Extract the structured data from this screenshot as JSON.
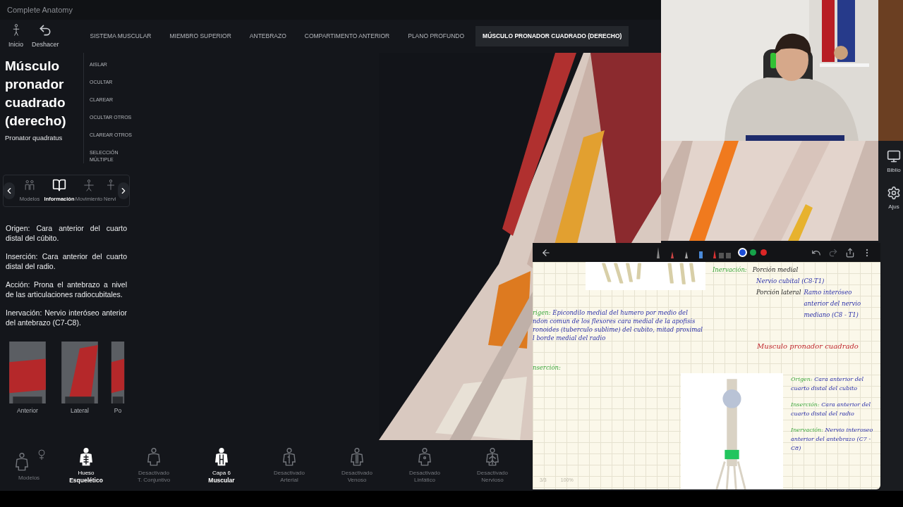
{
  "window": {
    "title": "Complete Anatomy"
  },
  "toolbar": [
    {
      "label": "Inicio",
      "kind": "home"
    },
    {
      "label": "Deshacer",
      "kind": "undo"
    }
  ],
  "breadcrumbs": [
    {
      "label": "SISTEMA MUSCULAR",
      "selected": false
    },
    {
      "label": "MIEMBRO SUPERIOR",
      "selected": false
    },
    {
      "label": "ANTEBRAZO",
      "selected": false
    },
    {
      "label": "COMPARTIMENTO ANTERIOR",
      "selected": false
    },
    {
      "label": "PLANO PROFUNDO",
      "selected": false
    },
    {
      "label": "MÚSCULO PRONADOR CUADRADO (DERECHO)",
      "selected": true
    }
  ],
  "structure": {
    "title": "Músculo pronador cuadrado (derecho)",
    "latin": "Pronator quadratus"
  },
  "actions": [
    "AISLAR",
    "OCULTAR",
    "CLAREAR",
    "OCULTAR OTROS",
    "CLAREAR OTROS",
    "SELECCIÓN MÚLTIPLE"
  ],
  "panel_tabs": [
    {
      "label": "Modelos",
      "kind": "models",
      "selected": false
    },
    {
      "label": "Información",
      "kind": "info",
      "selected": true
    },
    {
      "label": "Movimiento",
      "kind": "movement",
      "selected": false
    },
    {
      "label": "Nervi",
      "kind": "nerve",
      "selected": false
    }
  ],
  "info": [
    "Origen: Cara anterior del cuarto distal del cúbito.",
    "Inserción: Cara anterior del cuarto distal del radio.",
    "Acción: Prona el antebrazo a nivel de las articulaciones radiocubitales.",
    "Inervación: Nervio interóseo anterior del antebrazo (C7-C8)."
  ],
  "views": [
    "Anterior",
    "Lateral",
    "Po"
  ],
  "layers": [
    {
      "kind": "models",
      "top": "Modelos",
      "active": false
    },
    {
      "kind": "bone",
      "top": "Hueso",
      "bottom": "Esquelético",
      "active": true
    },
    {
      "kind": "connective",
      "top": "Desactivado",
      "bottom": "T. Conjuntivo",
      "active": false
    },
    {
      "kind": "muscle",
      "top": "Capa 6",
      "bottom": "Muscular",
      "active": true
    },
    {
      "kind": "arterial",
      "top": "Desactivado",
      "bottom": "Arterial",
      "active": false
    },
    {
      "kind": "venous",
      "top": "Desactivado",
      "bottom": "Venoso",
      "active": false
    },
    {
      "kind": "lymph",
      "top": "Desactivado",
      "bottom": "Linfático",
      "active": false
    },
    {
      "kind": "nerve",
      "top": "Desactivado",
      "bottom": "Nervioso",
      "active": false
    }
  ],
  "side_buttons": [
    {
      "label": "Biblio",
      "kind": "library"
    },
    {
      "label": "Ajus",
      "kind": "settings"
    }
  ],
  "notes": {
    "colors": [
      {
        "color": "#1d4ed8",
        "selected": true
      },
      {
        "color": "#16a34a",
        "selected": false
      },
      {
        "color": "#dc2626",
        "selected": false
      }
    ],
    "top_right": {
      "label": "Inervación:",
      "lines": [
        {
          "left": "Porción medial",
          "right": "Nervio cubital (C8-T1)"
        },
        {
          "left": "Porción lateral",
          "right": "Ramo interóseo anterior del nervio mediano (C8 - T1)"
        }
      ]
    },
    "origin": {
      "label": "rigen:",
      "lines": [
        "Epicondilo medial del humero por medio del",
        "ndon comun de los flexores cara medial de la apofisis",
        "ronoides (tuberculo sublime) del cubito, mitad proximal",
        "l borde medial del radio"
      ]
    },
    "insertion_label": "nserción:",
    "heading": "Musculo pronador cuadrado",
    "summary": [
      {
        "label": "Origen:",
        "text": "Cara anterior del cuarto distal del cubito"
      },
      {
        "label": "Inserción:",
        "text": "Cara anterior del cuarto distal del radio"
      },
      {
        "label": "Inervación:",
        "text": "Nervio interoseo anterior del antebrazo (C7 - C8)"
      }
    ],
    "page": "3/3",
    "zoom": "100%"
  }
}
